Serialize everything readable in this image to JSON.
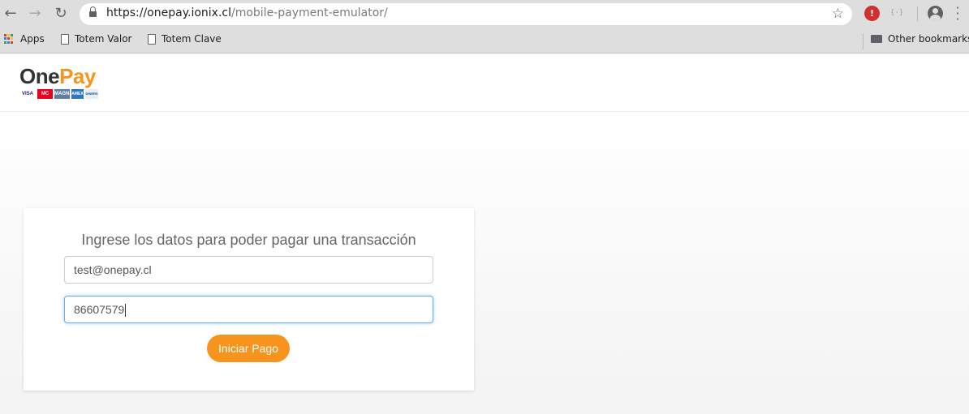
{
  "browser": {
    "url_host": "https://onepay.ionix.cl",
    "url_path": "/mobile-payment-emulator/",
    "ext_gray_text": "{·}",
    "bookmarks": [
      {
        "label": "Apps",
        "icon": "apps-grid-icon"
      },
      {
        "label": "Totem Valor",
        "icon": "page-icon"
      },
      {
        "label": "Totem Clave",
        "icon": "page-icon"
      }
    ],
    "other_bookmarks": "Other bookmarks"
  },
  "logo": {
    "one": "One",
    "pay": "Pay",
    "cards": [
      "VISA",
      "MC",
      "MAGNA",
      "AMEX",
      "DINERS"
    ]
  },
  "form": {
    "title": "Ingrese los datos para poder pagar una transacción",
    "email_value": "test@onepay.cl",
    "phone_value": "86607579",
    "submit_label": "Iniciar Pago"
  },
  "colors": {
    "brand_orange": "#f7941d",
    "focus_blue": "#66afe9"
  }
}
